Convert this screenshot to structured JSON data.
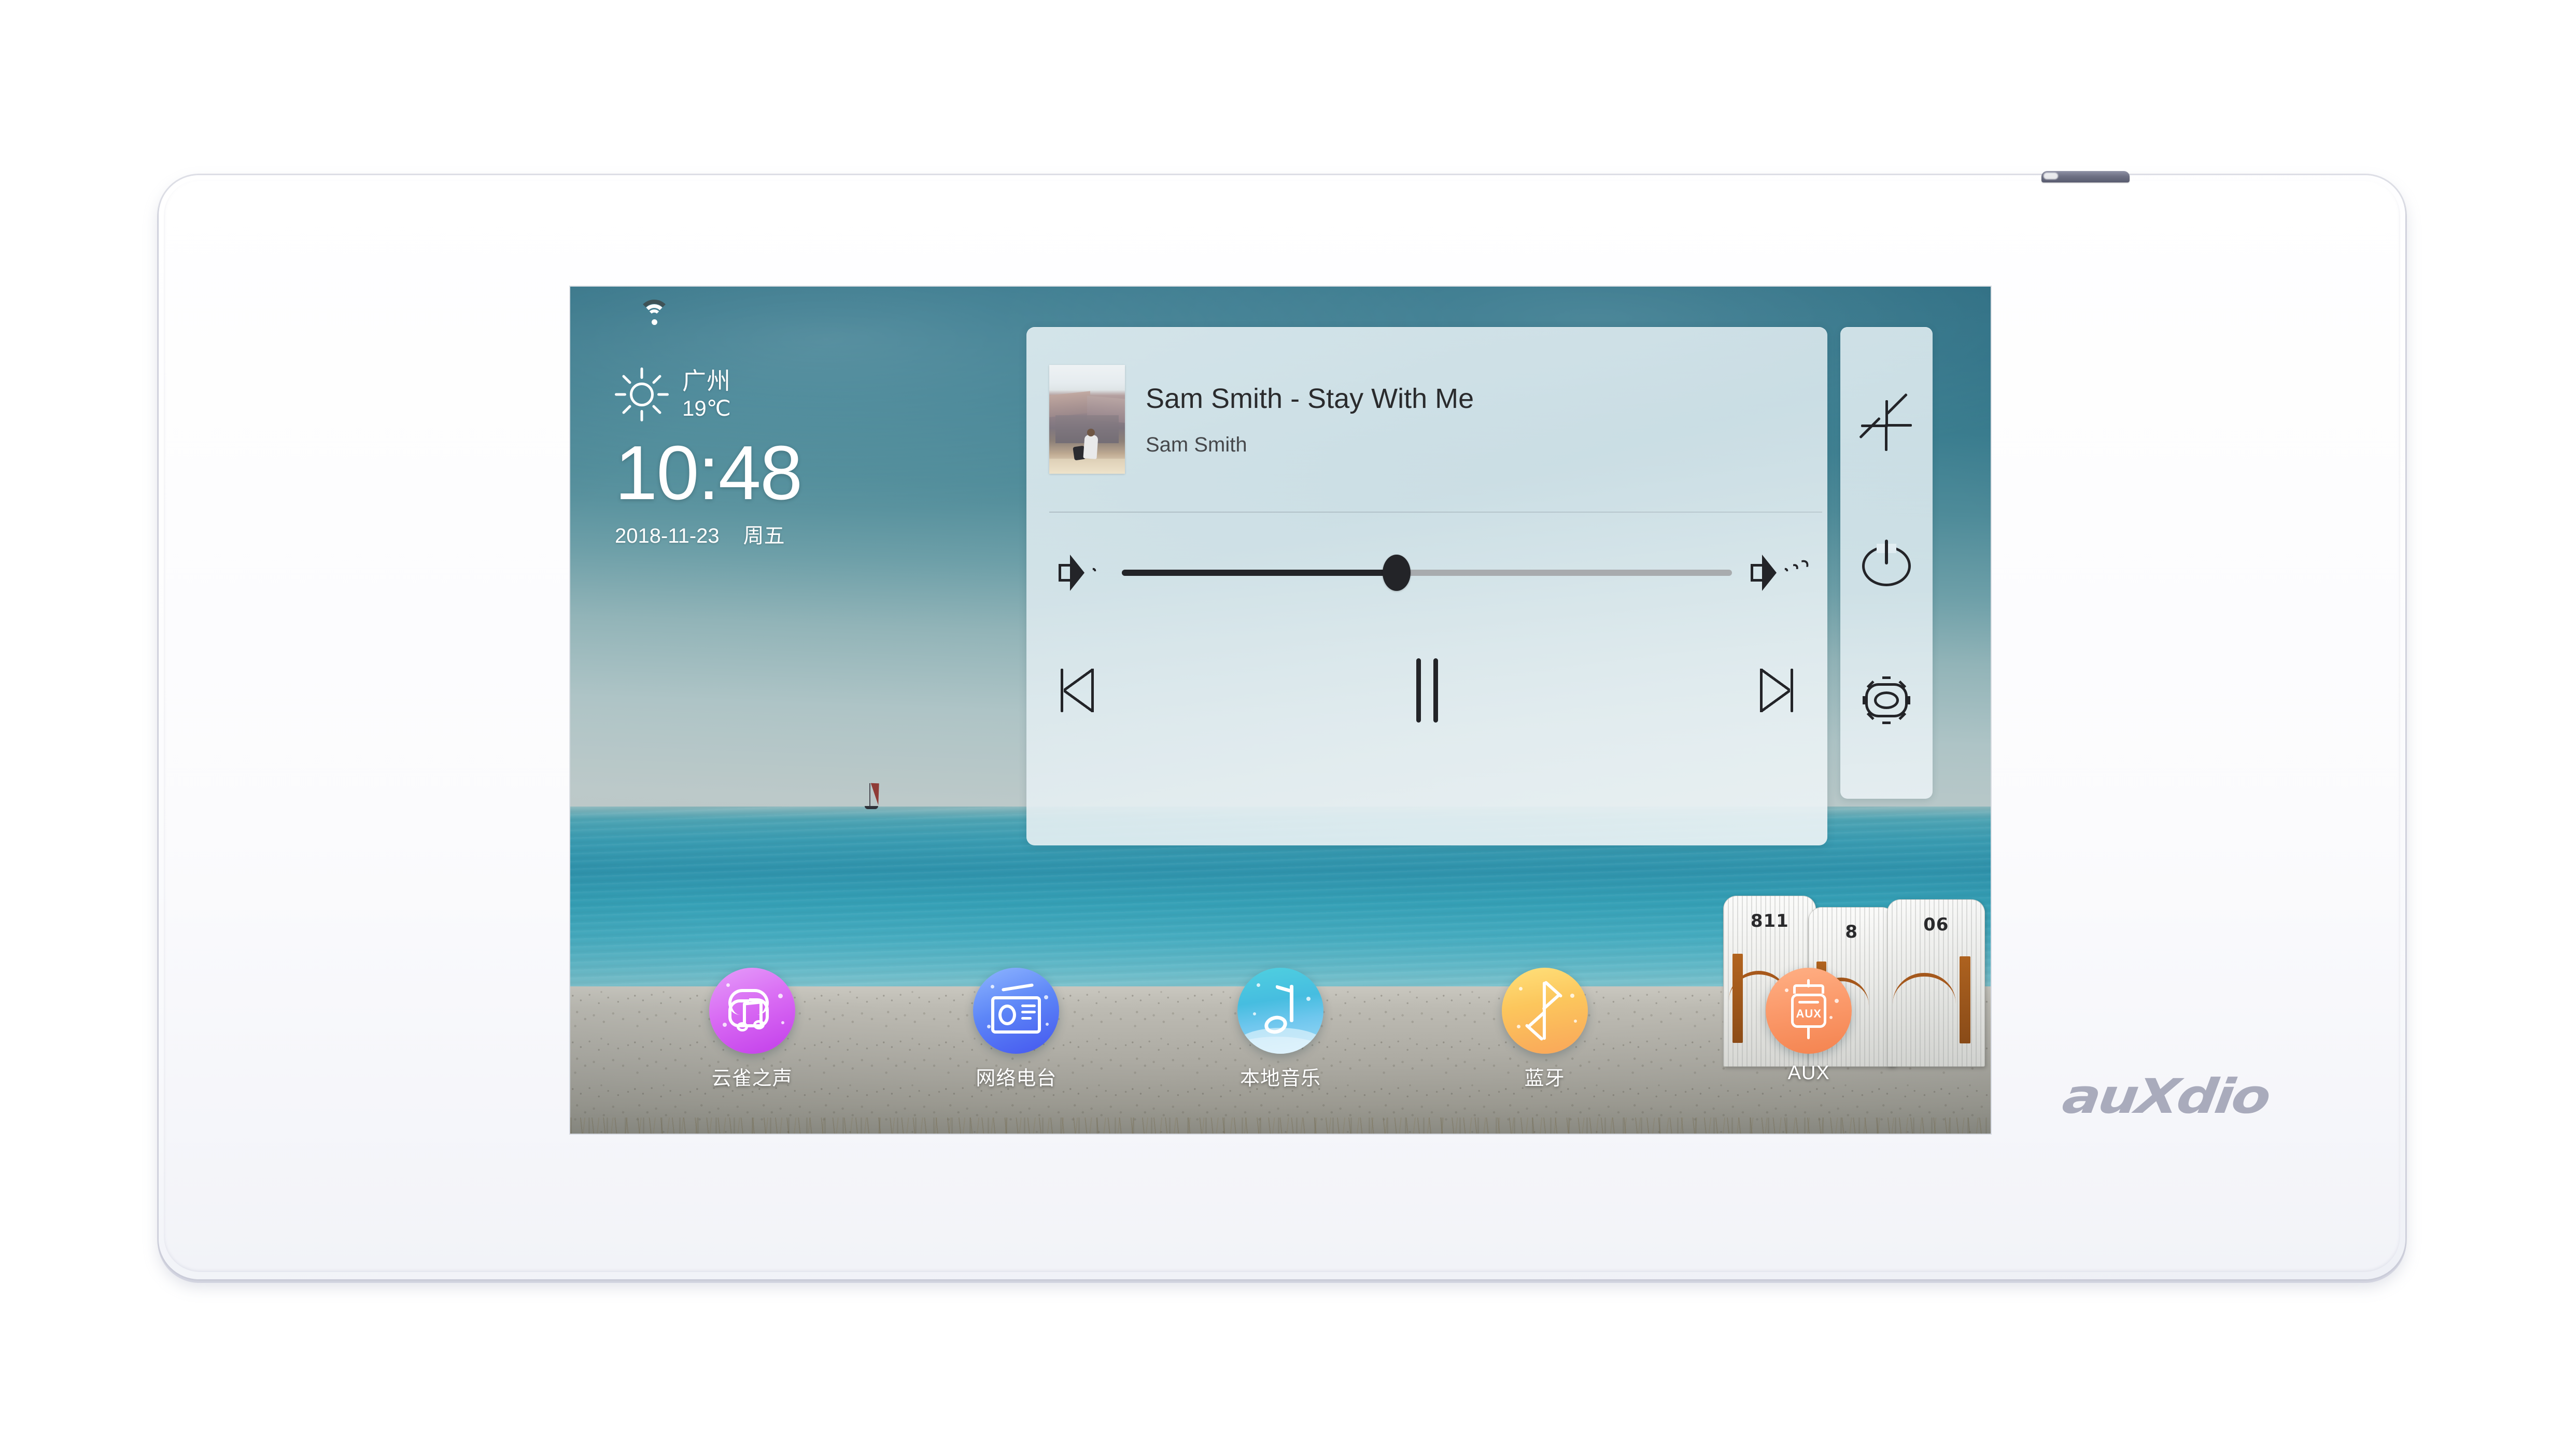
{
  "device": {
    "brand_logo_text": "auXdio",
    "top_tab_name": "mounting-clip"
  },
  "screen": {
    "status_bar": {
      "wifi_icon": "wifi-icon"
    },
    "weather": {
      "icon": "sun-icon",
      "city": "广州",
      "temperature": "19℃"
    },
    "clock": {
      "time": "10:48",
      "date": "2018-11-23",
      "weekday": "周五"
    },
    "player": {
      "album_art_icon": "album-art",
      "track_title": "Sam Smith - Stay With Me",
      "artist": "Sam Smith",
      "volume": {
        "low_icon": "volume-low-icon",
        "high_icon": "volume-high-icon",
        "level_percent": 45
      },
      "transport": {
        "previous_icon": "skip-previous-icon",
        "play_pause_icon": "pause-icon",
        "next_icon": "skip-next-icon",
        "state": "playing"
      }
    },
    "side_controls": [
      {
        "name": "collapse-icon",
        "label": "collapse"
      },
      {
        "name": "power-icon",
        "label": "power"
      },
      {
        "name": "gear-icon",
        "label": "settings"
      }
    ],
    "dock": [
      {
        "label": "云雀之声",
        "icon": "cloud-music-icon",
        "color": "#d869f3"
      },
      {
        "label": "网络电台",
        "icon": "radio-icon",
        "color": "#5d86f7"
      },
      {
        "label": "本地音乐",
        "icon": "music-note-icon",
        "color": "#46bde0"
      },
      {
        "label": "蓝牙",
        "icon": "bluetooth-icon",
        "color": "#fcc65c"
      },
      {
        "label": "AUX",
        "icon": "aux-plug-icon",
        "color": "#fb9a6b"
      }
    ],
    "wallpaper": {
      "scene": "beach",
      "beach_chair_numbers": [
        "811",
        "8",
        "06"
      ],
      "aux_glyph_text": "AUX"
    }
  }
}
